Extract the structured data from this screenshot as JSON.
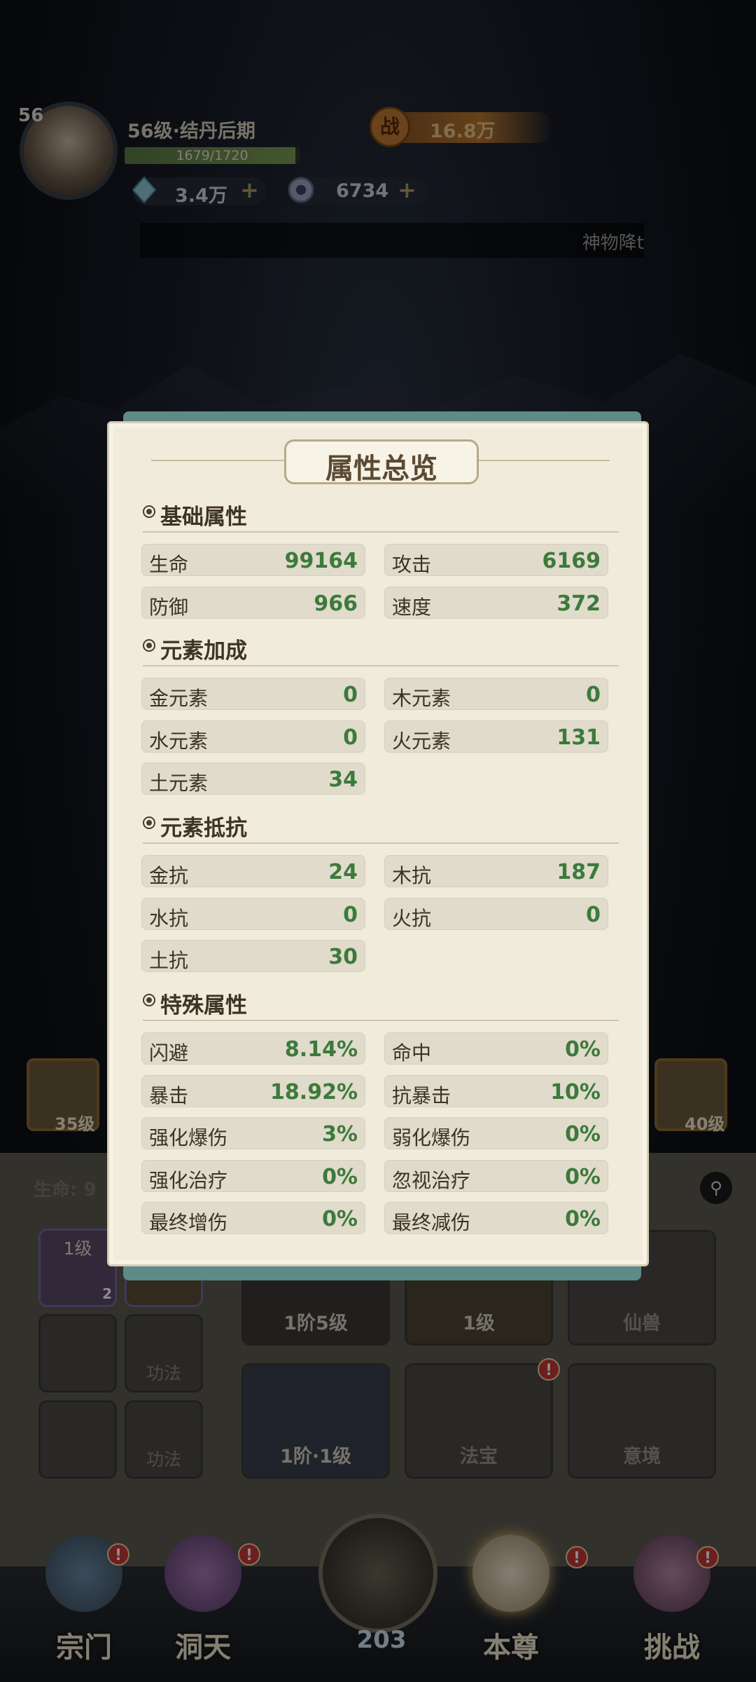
{
  "player": {
    "avatar_level": "56",
    "level_text": "56级·结丹后期",
    "exp_text": "1679/1720",
    "exp_fraction": 0.976,
    "power_icon": "战",
    "power_value": "16.8万",
    "currency_1": "3.4万",
    "currency_2": "6734",
    "plus": "+"
  },
  "marquee": "神物降t",
  "modal": {
    "title": "属性总览",
    "sections": [
      {
        "title": "基础属性",
        "stats": [
          {
            "label": "生命",
            "value": "99164"
          },
          {
            "label": "攻击",
            "value": "6169"
          },
          {
            "label": "防御",
            "value": "966"
          },
          {
            "label": "速度",
            "value": "372"
          }
        ]
      },
      {
        "title": "元素加成",
        "stats": [
          {
            "label": "金元素",
            "value": "0"
          },
          {
            "label": "木元素",
            "value": "0"
          },
          {
            "label": "水元素",
            "value": "0"
          },
          {
            "label": "火元素",
            "value": "131"
          },
          {
            "label": "土元素",
            "value": "34"
          }
        ]
      },
      {
        "title": "元素抵抗",
        "stats": [
          {
            "label": "金抗",
            "value": "24"
          },
          {
            "label": "木抗",
            "value": "187"
          },
          {
            "label": "水抗",
            "value": "0"
          },
          {
            "label": "火抗",
            "value": "0"
          },
          {
            "label": "土抗",
            "value": "30"
          }
        ]
      },
      {
        "title": "特殊属性",
        "stats": [
          {
            "label": "闪避",
            "value": "8.14%"
          },
          {
            "label": "命中",
            "value": "0%"
          },
          {
            "label": "暴击",
            "value": "18.92%"
          },
          {
            "label": "抗暴击",
            "value": "10%"
          },
          {
            "label": "强化爆伤",
            "value": "3%"
          },
          {
            "label": "弱化爆伤",
            "value": "0%"
          },
          {
            "label": "强化治疗",
            "value": "0%"
          },
          {
            "label": "忽视治疗",
            "value": "0%"
          },
          {
            "label": "最终增伤",
            "value": "0%"
          },
          {
            "label": "最终减伤",
            "value": "0%"
          }
        ]
      }
    ]
  },
  "background": {
    "hp_label": "生命: 9",
    "left_card_level": "35级",
    "right_card_level": "40级",
    "skill_level": "1级",
    "skill_badge": "2",
    "gong_fa": "功法",
    "slots": [
      {
        "label": "1阶5级"
      },
      {
        "label": "1级"
      },
      {
        "label": "仙兽"
      },
      {
        "label": "1阶·1级"
      },
      {
        "label": "法宝"
      },
      {
        "label": "意境"
      }
    ],
    "badge": "!"
  },
  "nav": {
    "items": [
      "宗门",
      "洞天",
      "本尊",
      "挑战"
    ],
    "center_value": "203"
  }
}
